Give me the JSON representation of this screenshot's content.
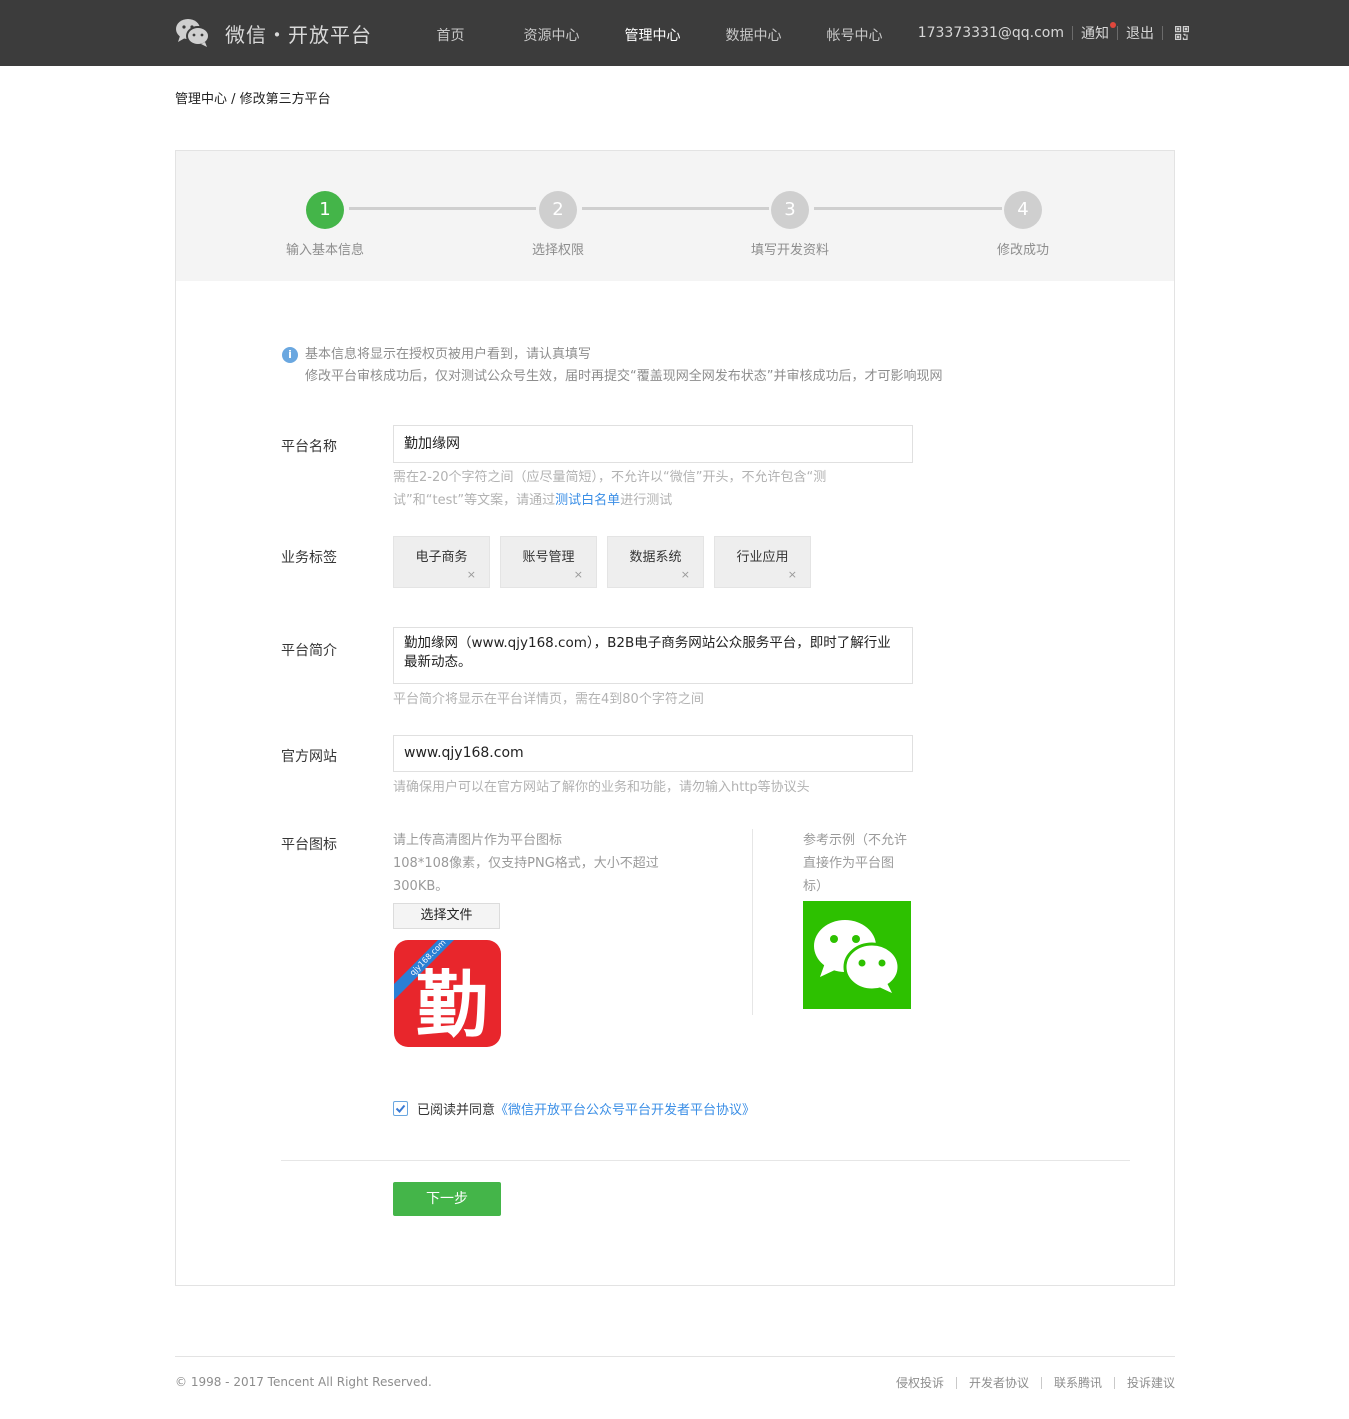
{
  "header": {
    "logo_text": "微信・开放平台",
    "nav": [
      "首页",
      "资源中心",
      "管理中心",
      "数据中心",
      "帐号中心"
    ],
    "active_nav_index": 2,
    "account": "173373331@qq.com",
    "notice": "通知",
    "logout": "退出"
  },
  "breadcrumb": "管理中心 / 修改第三方平台",
  "steps": [
    {
      "num": "1",
      "label": "输入基本信息"
    },
    {
      "num": "2",
      "label": "选择权限"
    },
    {
      "num": "3",
      "label": "填写开发资料"
    },
    {
      "num": "4",
      "label": "修改成功"
    }
  ],
  "info": {
    "icon": "i",
    "line1": "基本信息将显示在授权页被用户看到，请认真填写",
    "line2": "修改平台审核成功后，仅对测试公众号生效，届时再提交“覆盖现网全网发布状态”并审核成功后，才可影响现网"
  },
  "form": {
    "name_label": "平台名称",
    "name_value": "勤加缘网",
    "name_hint_1": "需在2-20个字符之间（应尽量简短），不允许以“微信”开头，不允许包含“测",
    "name_hint_2a": "试”和“test”等文案，请通过",
    "name_hint_link": "测试白名单",
    "name_hint_2b": "进行测试",
    "tags_label": "业务标签",
    "tags": [
      "电子商务",
      "账号管理",
      "数据系统",
      "行业应用"
    ],
    "tag_remove": "×",
    "intro_label": "平台简介",
    "intro_value": "勤加缘网（www.qjy168.com），B2B电子商务网站公众服务平台，即时了解行业最新动态。",
    "intro_hint": "平台简介将显示在平台详情页，需在4到80个字符之间",
    "site_label": "官方网站",
    "site_value": "www.qjy168.com",
    "site_hint": "请确保用户可以在官方网站了解你的业务和功能，请勿输入http等协议头",
    "icon_label": "平台图标",
    "icon_desc_1": "请上传高清图片作为平台图标",
    "icon_desc_2": "108*108像素，仅支持PNG格式，大小不超过",
    "icon_desc_3": "300KB。",
    "choose_file": "选择文件",
    "uploaded_icon_char": "勤",
    "uploaded_icon_ribbon": "qjy168.com",
    "ref_desc": "参考示例（不允许直接作为平台图标）",
    "agree_text": "已阅读并同意",
    "agree_link": "《微信开放平台公众号平台开发者平台协议》",
    "agree_checked": true,
    "next": "下一步"
  },
  "footer": {
    "copyright": "© 1998 - 2017 Tencent All Right Reserved.",
    "links": [
      "侵权投诉",
      "开发者协议",
      "联系腾讯",
      "投诉建议"
    ]
  },
  "colors": {
    "header_bg": "#3c3c3c",
    "accent_green": "#44b549",
    "link_blue": "#3a8ee6",
    "step_inactive": "#cfcfcf",
    "icon_red": "#e8262c"
  }
}
